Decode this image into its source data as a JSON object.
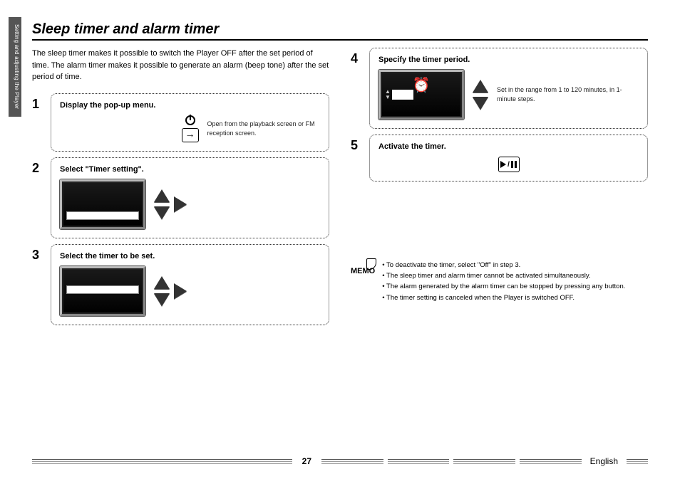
{
  "side_tab": "Setting and adjusting the Player",
  "title": "Sleep timer and alarm timer",
  "intro": "The sleep timer makes it possible to switch the Player OFF after the set period of time. The alarm timer makes it possible to generate an alarm (beep tone) after the set period of time.",
  "steps": {
    "s1": {
      "num": "1",
      "title": "Display the pop-up menu.",
      "desc": "Open from the playback screen or FM reception screen."
    },
    "s2": {
      "num": "2",
      "title": "Select \"Timer setting\"."
    },
    "s3": {
      "num": "3",
      "title": "Select the timer to be set."
    },
    "s4": {
      "num": "4",
      "title": "Specify the timer period.",
      "desc": "Set in the range from 1 to 120 minutes, in 1-minute steps."
    },
    "s5": {
      "num": "5",
      "title": "Activate the timer."
    }
  },
  "memo": {
    "label": "MEMO",
    "items": [
      "To deactivate the timer, select \"Off\" in step 3.",
      "The sleep timer and alarm timer cannot be activated simultaneously.",
      "The alarm generated by the alarm timer can be stopped by pressing any button.",
      "The timer setting is canceled when the Player is switched OFF."
    ]
  },
  "footer": {
    "page": "27",
    "lang": "English"
  }
}
